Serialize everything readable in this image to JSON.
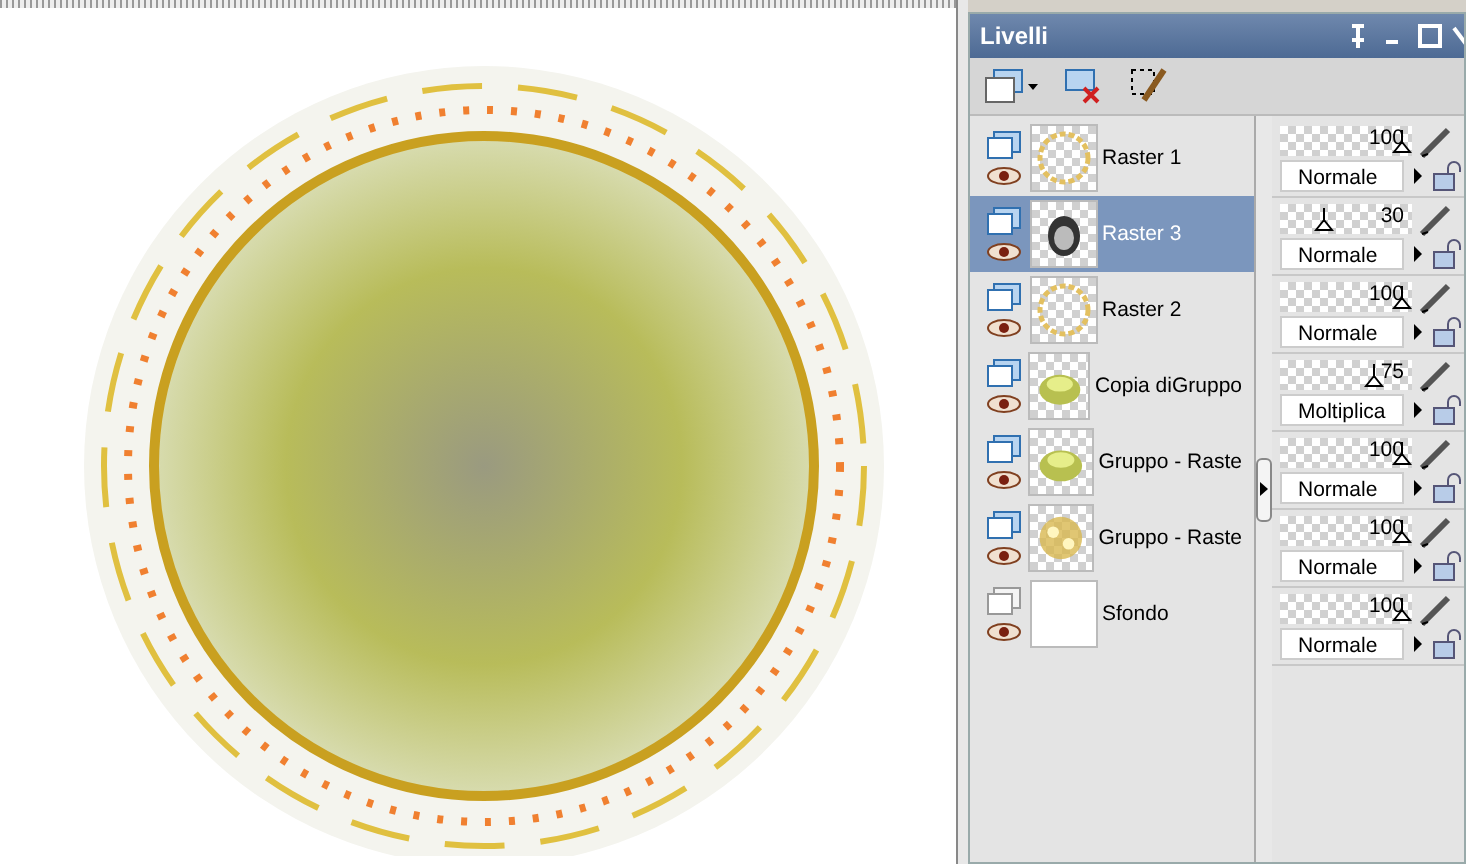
{
  "panel": {
    "title": "Livelli"
  },
  "layers": [
    {
      "name": "Raster 1",
      "kind": "ring",
      "selected": false,
      "opacity": "100",
      "level": 1,
      "blend": "Normale"
    },
    {
      "name": "Raster 3",
      "kind": "photo",
      "selected": true,
      "opacity": "30",
      "level": 0.3,
      "blend": "Normale"
    },
    {
      "name": "Raster 2",
      "kind": "ring",
      "selected": false,
      "opacity": "100",
      "level": 1,
      "blend": "Normale"
    },
    {
      "name": "Copia diGruppo",
      "kind": "glow",
      "selected": false,
      "opacity": "75",
      "level": 0.75,
      "blend": "Moltiplica"
    },
    {
      "name": "Gruppo - Raste",
      "kind": "glow",
      "selected": false,
      "opacity": "100",
      "level": 1,
      "blend": "Normale"
    },
    {
      "name": "Gruppo - Raste",
      "kind": "flowers",
      "selected": false,
      "opacity": "100",
      "level": 1,
      "blend": "Normale"
    },
    {
      "name": "Sfondo",
      "kind": "blank",
      "selected": false,
      "opacity": "100",
      "level": 1,
      "blend": "Normale"
    }
  ]
}
